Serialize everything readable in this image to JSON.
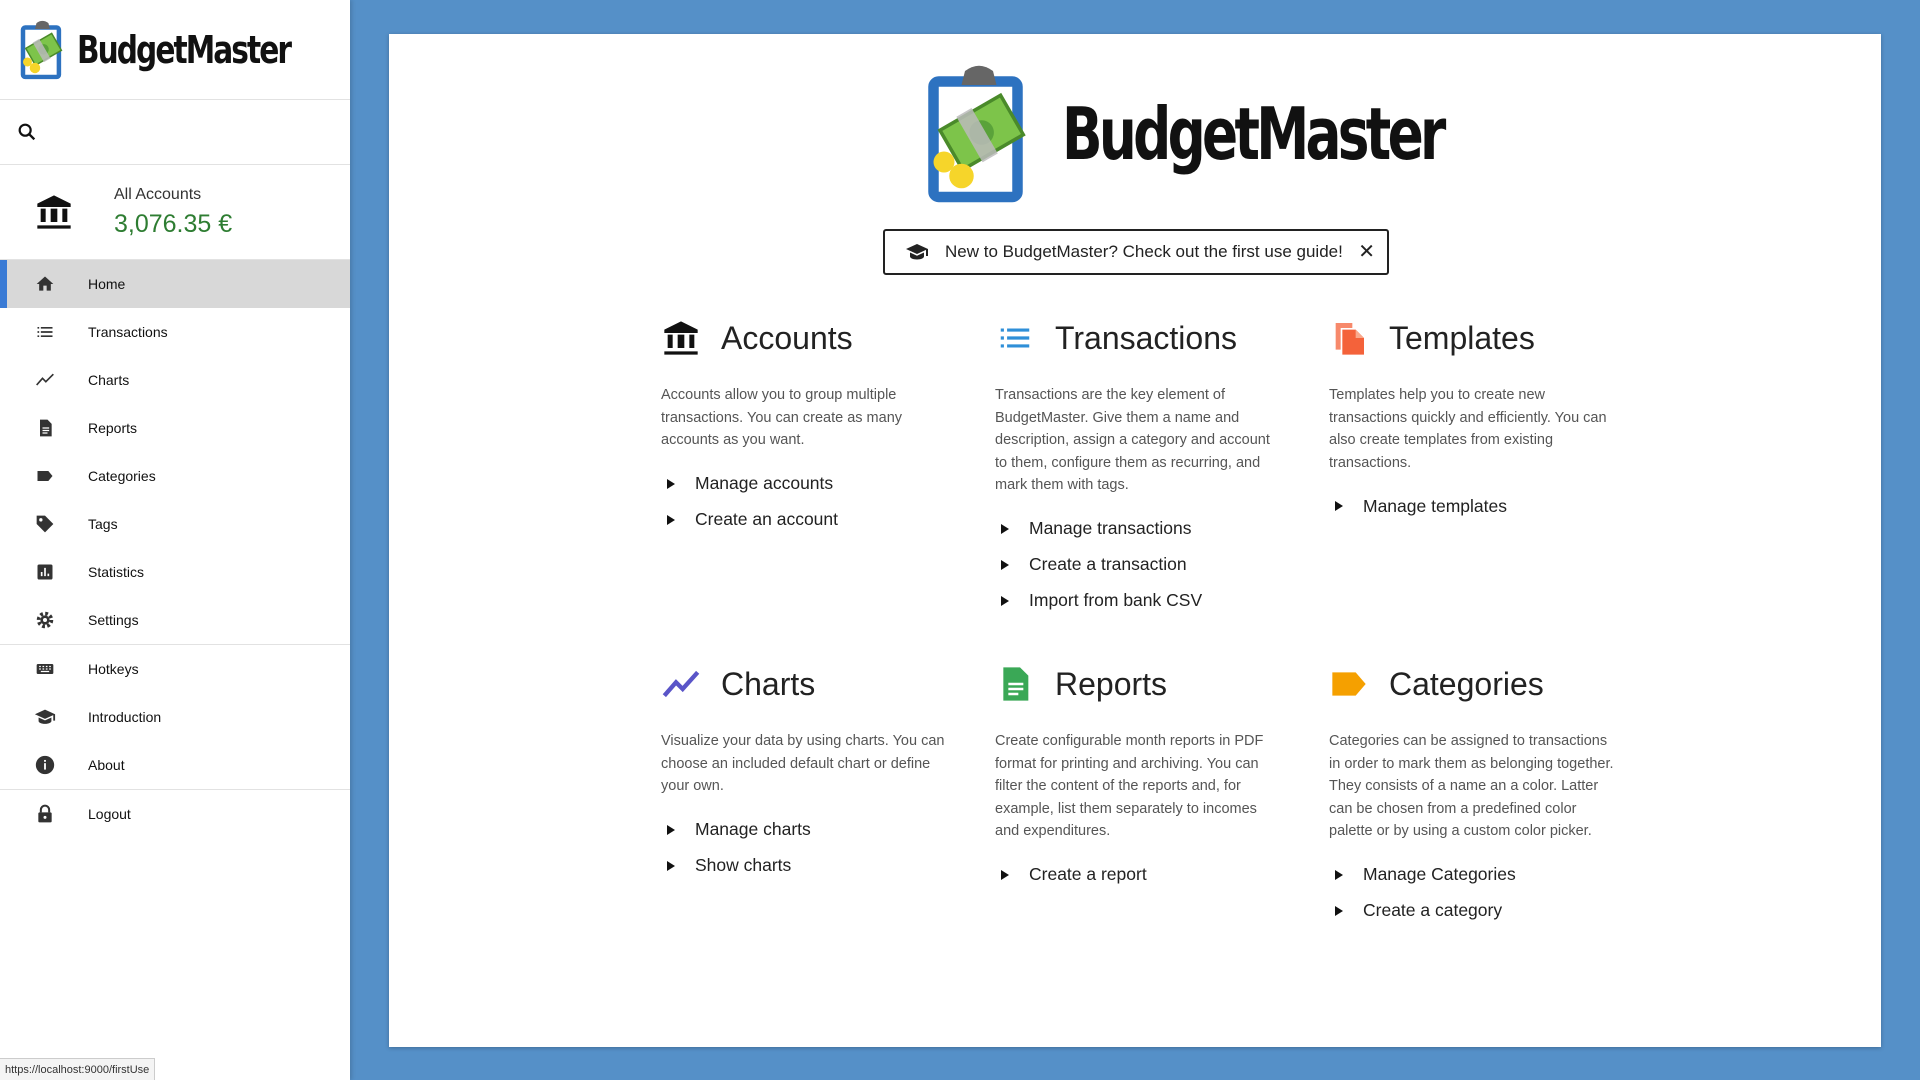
{
  "app": {
    "name": "BudgetMaster"
  },
  "sidebar": {
    "account": {
      "name": "All Accounts",
      "balance": "3,076.35 €"
    },
    "nav": [
      {
        "label": "Home",
        "icon": "home-icon",
        "active": true
      },
      {
        "label": "Transactions",
        "icon": "list-icon"
      },
      {
        "label": "Charts",
        "icon": "chart-line-icon"
      },
      {
        "label": "Reports",
        "icon": "document-icon"
      },
      {
        "label": "Categories",
        "icon": "label-icon"
      },
      {
        "label": "Tags",
        "icon": "tag-icon"
      },
      {
        "label": "Statistics",
        "icon": "bar-chart-icon"
      },
      {
        "label": "Settings",
        "icon": "gear-icon"
      },
      {
        "label": "Hotkeys",
        "icon": "keyboard-icon"
      },
      {
        "label": "Introduction",
        "icon": "graduation-cap-icon"
      },
      {
        "label": "About",
        "icon": "info-icon"
      },
      {
        "label": "Logout",
        "icon": "lock-icon"
      }
    ]
  },
  "status_url": "https://localhost:9000/firstUse",
  "guide_banner": {
    "text": "New to BudgetMaster? Check out the first use guide!",
    "icon": "graduation-cap-icon",
    "close": "✕"
  },
  "features": [
    {
      "title": "Accounts",
      "icon": "bank-icon",
      "color": "#111111",
      "description": "Accounts allow you to group multiple transactions. You can create as many accounts as you want.",
      "links": [
        "Manage accounts",
        "Create an account"
      ]
    },
    {
      "title": "Transactions",
      "icon": "list-icon",
      "color": "#2f8fd8",
      "description": "Transactions are the key element of BudgetMaster. Give them a name and description, assign a category and account to them, configure them as recurring, and mark them with tags.",
      "links": [
        "Manage transactions",
        "Create a transaction",
        "Import from bank CSV"
      ]
    },
    {
      "title": "Templates",
      "icon": "file-copy-icon",
      "color": "#f4623a",
      "description": "Templates help you to create new transactions quickly and efficiently. You can also create templates from existing transactions.",
      "links": [
        "Manage templates"
      ]
    },
    {
      "title": "Charts",
      "icon": "chart-line-icon",
      "color": "#5a55c8",
      "description": "Visualize your data by using charts. You can choose an included default chart or define your own.",
      "links": [
        "Manage charts",
        "Show charts"
      ]
    },
    {
      "title": "Reports",
      "icon": "document-icon",
      "color": "#3aa856",
      "description": "Create configurable month reports in PDF format for printing and archiving. You can filter the content of the reports and, for example, list them separately to incomes and expenditures.",
      "links": [
        "Create a report"
      ]
    },
    {
      "title": "Categories",
      "icon": "label-icon",
      "color": "#f5a000",
      "description": "Categories can be assigned to transactions in order to mark them as belonging together. They consists of a name an a color. Latter can be chosen from a predefined color palette or by using a custom color picker.",
      "links": [
        "Manage Categories",
        "Create a category"
      ]
    }
  ]
}
